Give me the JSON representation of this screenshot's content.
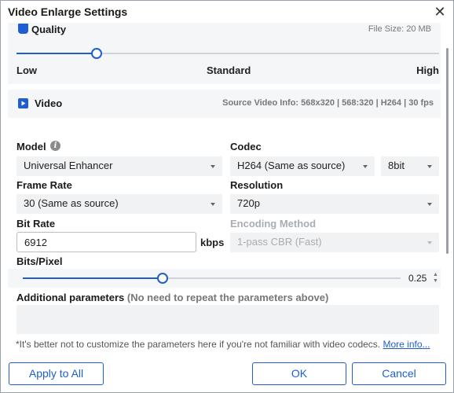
{
  "window": {
    "title": "Video Enlarge Settings",
    "close_icon": "close-icon"
  },
  "quality": {
    "title": "Quality",
    "file_size": "File Size:  20 MB",
    "slider_value": 0.19,
    "labels": {
      "low": "Low",
      "standard": "Standard",
      "high": "High"
    }
  },
  "video": {
    "title": "Video",
    "source_info": "Source Video Info: 568x320 | 568:320 | H264 | 30 fps",
    "model_label": "Model",
    "model_value": "Universal Enhancer",
    "codec_label": "Codec",
    "codec_value": "H264 (Same as source)",
    "bitdepth_value": "8bit",
    "framerate_label": "Frame Rate",
    "framerate_value": "30 (Same as source)",
    "resolution_label": "Resolution",
    "resolution_value": "720p",
    "bitrate_label": "Bit Rate",
    "bitrate_value": "6912",
    "bitrate_unit": "kbps",
    "encoding_label": "Encoding Method",
    "encoding_value": "1-pass CBR (Fast)",
    "bpp_label": "Bits/Pixel",
    "bpp_value": "0.25",
    "bpp_slider_value": 0.37,
    "additional_label": "Additional parameters",
    "additional_hint": "(No need to repeat the parameters above)",
    "additional_value": "",
    "note_text": "*It's better not to customize the parameters here if you're not familiar with video codecs.",
    "more_info": "More info..."
  },
  "buttons": {
    "apply_all": "Apply to All",
    "ok": "OK",
    "cancel": "Cancel"
  },
  "colors": {
    "accent": "#1f5ecf",
    "panel_bg": "#f5f6f8",
    "field_bg": "#f1f2f4"
  }
}
